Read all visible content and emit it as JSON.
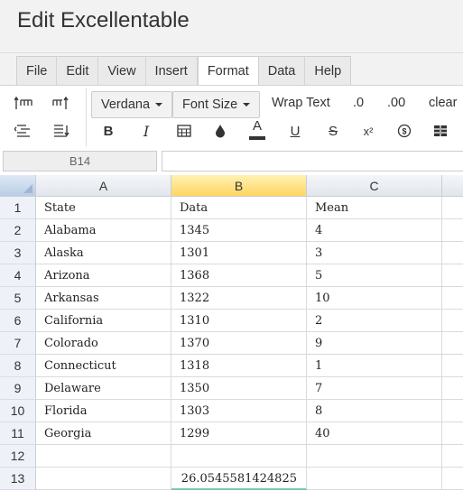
{
  "app": {
    "title": "Edit Excellentable"
  },
  "menu": {
    "tabs": [
      {
        "label": "File"
      },
      {
        "label": "Edit"
      },
      {
        "label": "View"
      },
      {
        "label": "Insert"
      },
      {
        "label": "Format"
      },
      {
        "label": "Data"
      },
      {
        "label": "Help"
      }
    ],
    "active": "Format"
  },
  "toolbar": {
    "font_family": "Verdana",
    "font_size": "Font Size",
    "wrap_text": "Wrap Text",
    "decrease_decimals": ".0",
    "increase_decimals": ".00",
    "clear": "clear",
    "bold": "B",
    "italic": "I",
    "text_color": "A",
    "underline": "U",
    "strike": "S",
    "superscript": "x²"
  },
  "formula": {
    "name_box": "B14",
    "value": ""
  },
  "columns": [
    "A",
    "B",
    "C"
  ],
  "selected_column": "B",
  "rows": [
    {
      "num": "1",
      "a": "State",
      "b": "Data",
      "c": "Mean"
    },
    {
      "num": "2",
      "a": "Alabama",
      "b": "1345",
      "c": "4"
    },
    {
      "num": "3",
      "a": "Alaska",
      "b": "1301",
      "c": "3"
    },
    {
      "num": "4",
      "a": "Arizona",
      "b": "1368",
      "c": "5"
    },
    {
      "num": "5",
      "a": "Arkansas",
      "b": "1322",
      "c": "10"
    },
    {
      "num": "6",
      "a": "California",
      "b": "1310",
      "c": "2"
    },
    {
      "num": "7",
      "a": "Colorado",
      "b": "1370",
      "c": "9"
    },
    {
      "num": "8",
      "a": "Connecticut",
      "b": "1318",
      "c": "1"
    },
    {
      "num": "9",
      "a": "Delaware",
      "b": "1350",
      "c": "7"
    },
    {
      "num": "10",
      "a": "Florida",
      "b": "1303",
      "c": "8"
    },
    {
      "num": "11",
      "a": "Georgia",
      "b": "1299",
      "c": "40"
    },
    {
      "num": "12",
      "a": "",
      "b": "",
      "c": ""
    },
    {
      "num": "13",
      "a": "",
      "b": "26.0545581424825",
      "c": ""
    }
  ],
  "colors": {
    "selected_header": "#ffd561",
    "active_cell_border": "#7ac9a6"
  }
}
